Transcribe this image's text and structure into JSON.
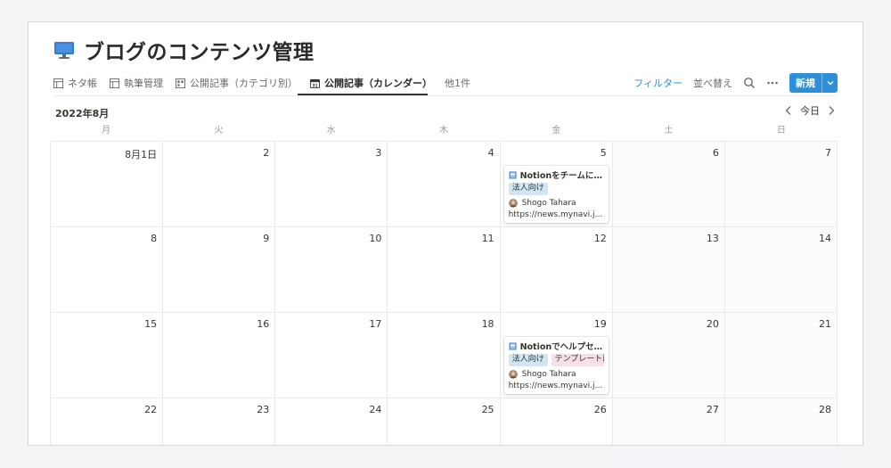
{
  "page": {
    "title": "ブログのコンテンツ管理",
    "icon": "computer-icon"
  },
  "tabs": [
    {
      "label": "ネタ帳",
      "icon": "table-icon",
      "active": false
    },
    {
      "label": "執筆管理",
      "icon": "table-icon",
      "active": false
    },
    {
      "label": "公開記事（カテゴリ別）",
      "icon": "board-icon",
      "active": false
    },
    {
      "label": "公開記事（カレンダー）",
      "icon": "calendar-icon",
      "active": true
    },
    {
      "label": "他1件",
      "icon": "",
      "active": false
    }
  ],
  "toolbar": {
    "filter_label": "フィルター",
    "sort_label": "並べ替え",
    "new_label": "新規",
    "accent": "#2d8fd8"
  },
  "calendar": {
    "month_label": "2022年8月",
    "today_label": "今日",
    "weekdays": [
      "月",
      "火",
      "水",
      "木",
      "金",
      "土",
      "日"
    ],
    "weeks": [
      [
        {
          "day": "8月1日"
        },
        {
          "day": "2"
        },
        {
          "day": "3"
        },
        {
          "day": "4"
        },
        {
          "day": "5",
          "card": {
            "title": "Notionをチームに浸…",
            "tags": [
              {
                "label": "法人向け",
                "color": "blue"
              }
            ],
            "person": "Shogo Tahara",
            "url": "https://news.mynavi.jp…"
          }
        },
        {
          "day": "6"
        },
        {
          "day": "7"
        }
      ],
      [
        {
          "day": "8"
        },
        {
          "day": "9"
        },
        {
          "day": "10"
        },
        {
          "day": "11"
        },
        {
          "day": "12"
        },
        {
          "day": "13"
        },
        {
          "day": "14"
        }
      ],
      [
        {
          "day": "15"
        },
        {
          "day": "16"
        },
        {
          "day": "17"
        },
        {
          "day": "18"
        },
        {
          "day": "19",
          "card": {
            "title": "Notionでヘルプセン…",
            "tags": [
              {
                "label": "法人向け",
                "color": "blue"
              },
              {
                "label": "テンプレート配",
                "color": "pink"
              }
            ],
            "person": "Shogo Tahara",
            "url": "https://news.mynavi.jp…"
          }
        },
        {
          "day": "20"
        },
        {
          "day": "21"
        }
      ],
      [
        {
          "day": "22"
        },
        {
          "day": "23"
        },
        {
          "day": "24"
        },
        {
          "day": "25"
        },
        {
          "day": "26"
        },
        {
          "day": "27"
        },
        {
          "day": "28"
        }
      ]
    ]
  }
}
